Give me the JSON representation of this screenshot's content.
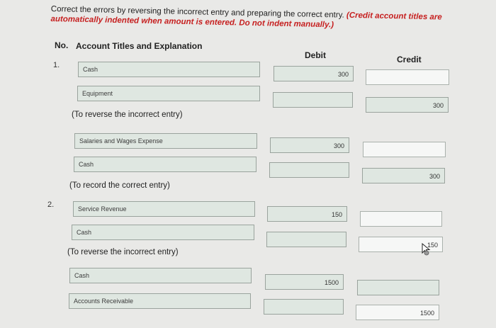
{
  "instructions": {
    "text": "Correct the errors by reversing the incorrect entry and preparing the correct entry.",
    "note": "(Credit account titles are automatically indented when amount is entered. Do not indent manually.)"
  },
  "table": {
    "col_no": "No.",
    "col_account": "Account Titles and Explanation",
    "col_debit": "Debit",
    "col_credit": "Credit"
  },
  "entries": [
    {
      "no": "1.",
      "lines": [
        {
          "account": "Cash",
          "debit": "300",
          "credit": ""
        },
        {
          "account": "Equipment",
          "debit": "",
          "credit": "300"
        }
      ],
      "caption1": "(To reverse the incorrect entry)",
      "lines2": [
        {
          "account": "Salaries and Wages Expense",
          "debit": "300",
          "credit": ""
        },
        {
          "account": "Cash",
          "debit": "",
          "credit": "300"
        }
      ],
      "caption2": "(To record the correct entry)"
    },
    {
      "no": "2.",
      "lines": [
        {
          "account": "Service Revenue",
          "debit": "150",
          "credit": ""
        },
        {
          "account": "Cash",
          "debit": "",
          "credit": "150"
        }
      ],
      "caption1": "(To reverse the incorrect entry)",
      "lines2": [
        {
          "account": "Cash",
          "debit": "1500",
          "credit": ""
        },
        {
          "account": "Accounts Receivable",
          "debit": "",
          "credit": "1500"
        }
      ]
    }
  ],
  "icons": {
    "cursor": "mouse-pointer-icon"
  }
}
